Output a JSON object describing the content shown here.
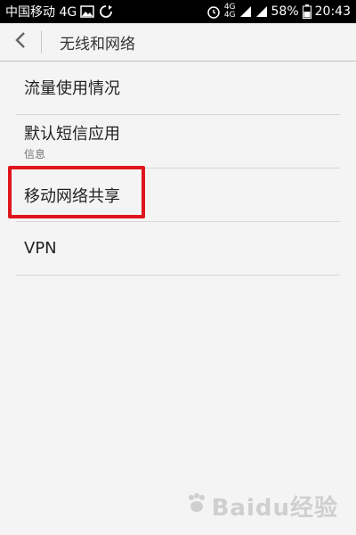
{
  "status_bar": {
    "carrier": "中国移动 4G",
    "network_top": "4G",
    "network_bottom": "4G",
    "battery": "58%",
    "time": "20:43"
  },
  "header": {
    "title": "无线和网络"
  },
  "items": [
    {
      "title": "流量使用情况"
    },
    {
      "title": "默认短信应用",
      "subtitle": "信息"
    },
    {
      "title": "移动网络共享"
    },
    {
      "title": "VPN"
    }
  ],
  "watermark": {
    "text": "Baidu经验"
  },
  "colors": {
    "highlight": "#e0151c",
    "background": "#f4f4f4",
    "status_bar": "#000000"
  }
}
